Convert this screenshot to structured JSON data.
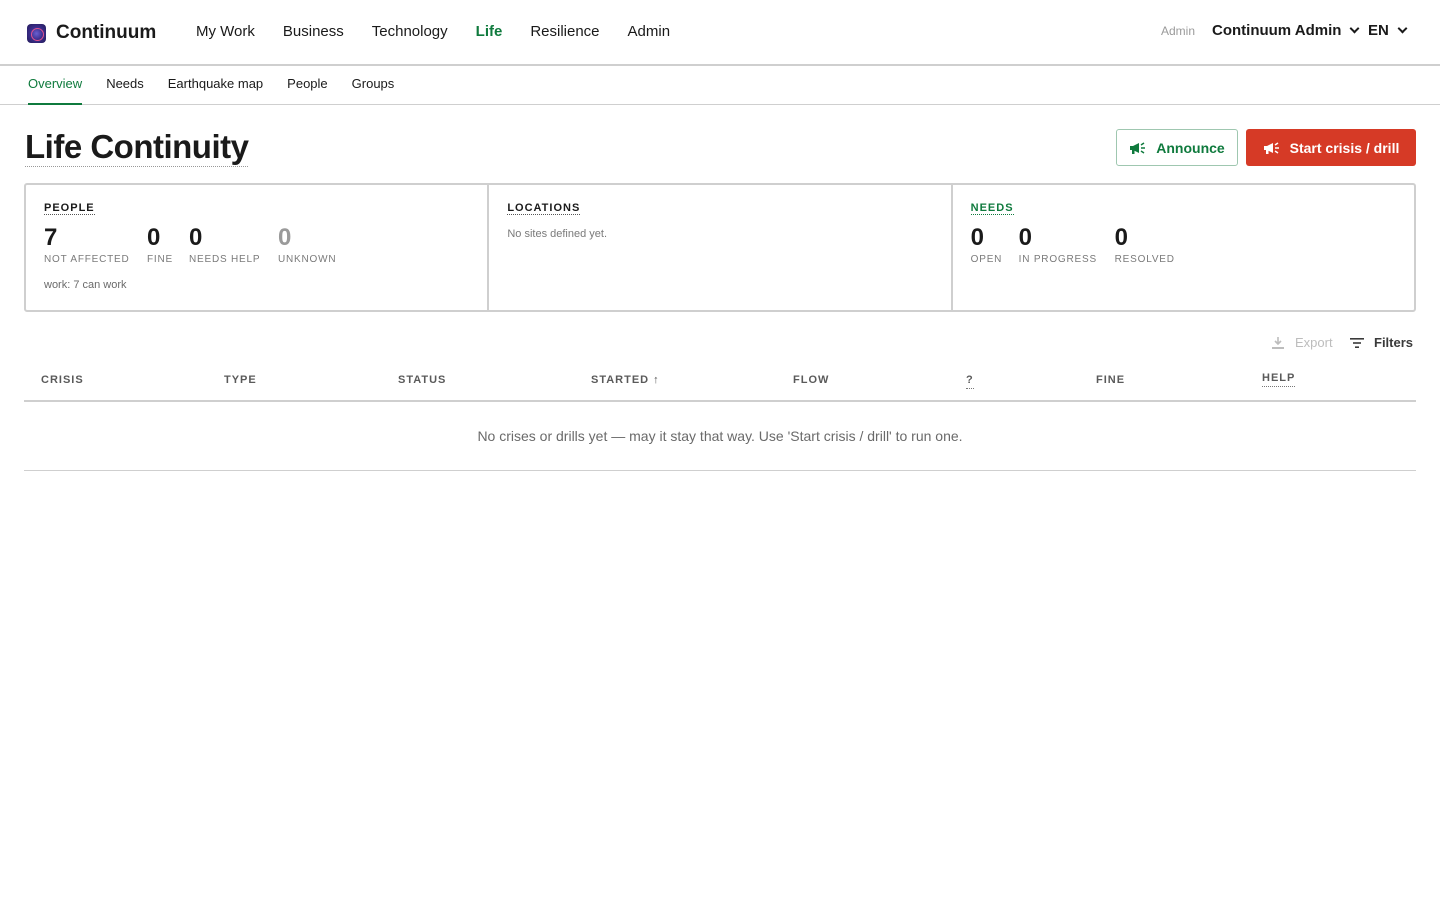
{
  "brand": {
    "name": "Continuum"
  },
  "nav": {
    "items": [
      {
        "label": "My Work"
      },
      {
        "label": "Business"
      },
      {
        "label": "Technology"
      },
      {
        "label": "Life"
      },
      {
        "label": "Resilience"
      },
      {
        "label": "Admin"
      }
    ],
    "active": "Life"
  },
  "user": {
    "role": "Admin",
    "name": "Continuum Admin",
    "language": "EN"
  },
  "subnav": {
    "items": [
      {
        "label": "Overview"
      },
      {
        "label": "Needs"
      },
      {
        "label": "Earthquake map"
      },
      {
        "label": "People"
      },
      {
        "label": "Groups"
      }
    ],
    "active": "Overview"
  },
  "page": {
    "title": "Life Continuity",
    "announce_label": "Announce",
    "start_label": "Start crisis / drill"
  },
  "stats": {
    "people": {
      "heading": "PEOPLE",
      "metrics": [
        {
          "value": "7",
          "label": "NOT AFFECTED"
        },
        {
          "value": "0",
          "label": "FINE"
        },
        {
          "value": "0",
          "label": "NEEDS HELP"
        },
        {
          "value": "0",
          "label": "UNKNOWN"
        }
      ],
      "note": "work: 7 can work"
    },
    "locations": {
      "heading": "LOCATIONS",
      "empty": "No sites defined yet."
    },
    "needs": {
      "heading": "NEEDS",
      "metrics": [
        {
          "value": "0",
          "label": "OPEN"
        },
        {
          "value": "0",
          "label": "IN PROGRESS"
        },
        {
          "value": "0",
          "label": "RESOLVED"
        }
      ]
    }
  },
  "toolbar": {
    "export_label": "Export",
    "filters_label": "Filters"
  },
  "table": {
    "columns": [
      "CRISIS",
      "TYPE",
      "STATUS",
      "STARTED",
      "FLOW",
      "?",
      "FINE",
      "HELP"
    ],
    "sorted_column": "STARTED",
    "sort_direction": "ascending",
    "empty_message": "No crises or drills yet — may it stay that way. Use 'Start crisis / drill' to run one."
  },
  "colors": {
    "accent": "#0f7a3d",
    "danger": "#d63a26",
    "border": "#cfcfcf"
  }
}
